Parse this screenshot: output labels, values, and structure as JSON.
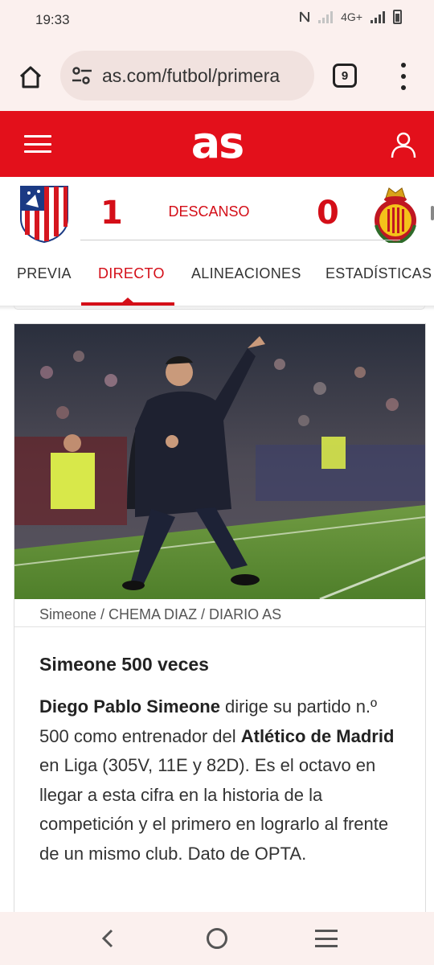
{
  "status_bar": {
    "time": "19:33",
    "network": "4G+",
    "icons": [
      "nfc-icon",
      "signal-weak-icon",
      "signal-icon",
      "battery-icon"
    ]
  },
  "browser": {
    "url": "as.com/futbol/primera",
    "tab_count": "9",
    "icons": [
      "home-icon",
      "site-settings-icon",
      "tabs-icon",
      "more-vert-icon"
    ]
  },
  "header": {
    "logo": "as",
    "icons": [
      "menu-icon",
      "user-icon"
    ],
    "brand_color": "#e3101b"
  },
  "scoreboard": {
    "home_score": "1",
    "away_score": "0",
    "status": "DESCANSO",
    "home_crest": "atletico-madrid-crest-icon",
    "away_crest": "mallorca-crest-icon"
  },
  "tabs": [
    {
      "label": "PREVIA",
      "active": false
    },
    {
      "label": "DIRECTO",
      "active": true
    },
    {
      "label": "ALINEACIONES",
      "active": false
    },
    {
      "label": "ESTADÍSTICAS",
      "active": false
    }
  ],
  "article": {
    "image_caption": "Simeone / CHEMA DIAZ / DIARIO AS",
    "headline": "Simeone 500 veces",
    "body": [
      {
        "text": "Diego Pablo Simeone",
        "bold": true
      },
      {
        "text": " dirige su partido n.º 500 como entrenador del ",
        "bold": false
      },
      {
        "text": "Atlético de Madrid",
        "bold": true
      },
      {
        "text": " en Liga (305V, 11E y 82D). Es el octavo en llegar a esta cifra en la historia de la competición y el primero en lograrlo al frente de un mismo club. Dato de OPTA.",
        "bold": false
      }
    ]
  },
  "nav_bar": {
    "icons": [
      "back-icon",
      "home-circle-icon",
      "recent-apps-icon"
    ]
  }
}
